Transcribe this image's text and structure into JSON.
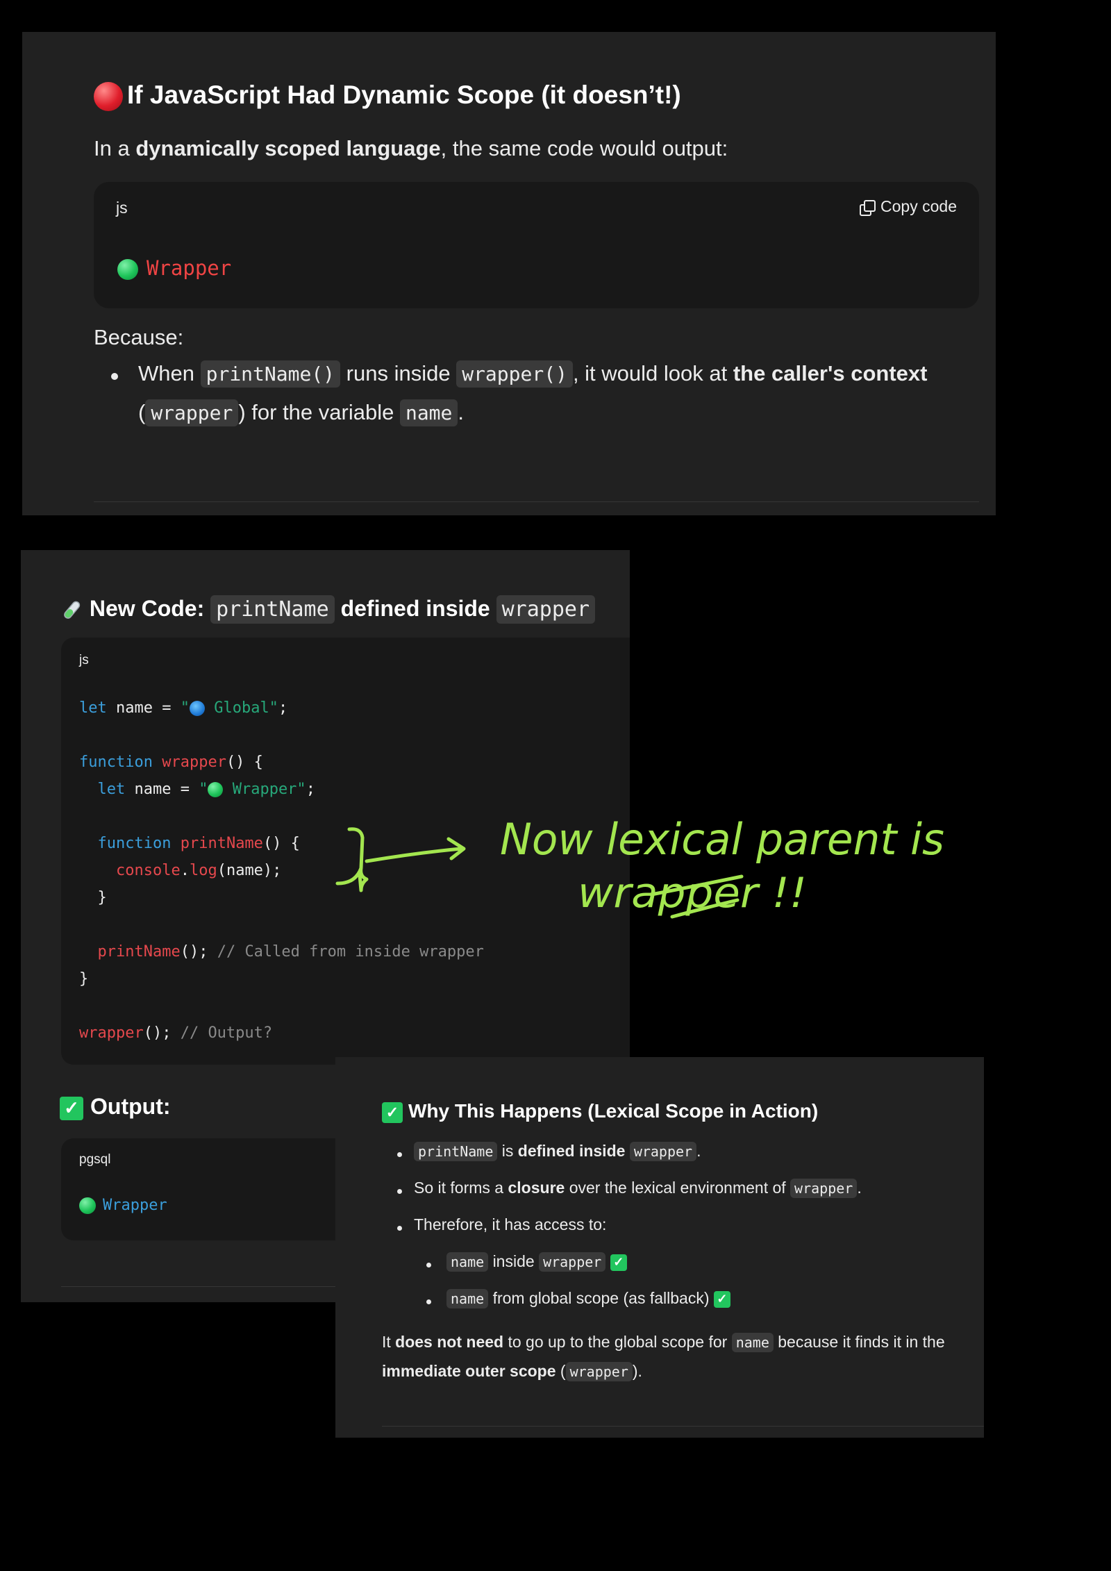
{
  "panel1": {
    "heading": "If JavaScript Had Dynamic Scope (it doesn’t!)",
    "intro_pre": "In a ",
    "intro_bold": "dynamically scoped language",
    "intro_post": ", the same code would output:",
    "code_lang": "js",
    "copy_label": "Copy code",
    "output_text": "Wrapper",
    "because": "Because:",
    "bullet_when": "When",
    "bullet_code1": "printName()",
    "bullet_runs": "runs inside",
    "bullet_code2": "wrapper()",
    "bullet_look": ", it would look at",
    "bullet_bold": "the caller's context",
    "bullet_open": "(",
    "bullet_code3": "wrapper",
    "bullet_close": ") for the variable",
    "bullet_code4": "name",
    "bullet_end": "."
  },
  "panel2": {
    "heading_pre": "New Code:",
    "heading_code1": "printName",
    "heading_mid": "defined inside",
    "heading_code2": "wrapper",
    "code_lang": "js",
    "code": {
      "l1_kw": "let",
      "l1_rest": " name = ",
      "l1_q": "\"",
      "l1_str": " Global\"",
      "l1_end": ";",
      "l3_kw": "function",
      "l3_fn": "wrapper",
      "l3_rest": "() {",
      "l4_kw": "let",
      "l4_rest": " name = ",
      "l4_q": "\"",
      "l4_str": " Wrapper\"",
      "l4_end": ";",
      "l6_kw": "function",
      "l6_fn": "printName",
      "l6_rest": "() {",
      "l7_obj": "console",
      "l7_dot": ".",
      "l7_fn": "log",
      "l7_rest": "(name);",
      "l8": "}",
      "l10_fn": "printName",
      "l10_rest": "(); ",
      "l10_cm": "// Called from inside wrapper",
      "l11": "}",
      "l13_fn": "wrapper",
      "l13_rest": "(); ",
      "l13_cm": "// Output?"
    },
    "output_heading": "Output:",
    "output_lang": "pgsql",
    "output_text": "Wrapper"
  },
  "panel3": {
    "heading": "Why This Happens (Lexical Scope in Action)",
    "b1_code1": "printName",
    "b1_is": "is",
    "b1_bold": "defined inside",
    "b1_code2": "wrapper",
    "b1_end": ".",
    "b2_pre": "So it forms a",
    "b2_bold": "closure",
    "b2_mid": "over the lexical environment of",
    "b2_code": "wrapper",
    "b2_end": ".",
    "b3": "Therefore, it has access to:",
    "s1_code1": "name",
    "s1_mid": "inside",
    "s1_code2": "wrapper",
    "s2_code": "name",
    "s2_rest": "from global scope (as fallback)",
    "p_it": "It",
    "p_bold1": "does not need",
    "p_mid": "to go up to the global scope for",
    "p_code": "name",
    "p_rest": "because it finds it in the",
    "p_bold2": "immediate outer scope",
    "p_open": "(",
    "p_code2": "wrapper",
    "p_close": ")."
  },
  "annotation": {
    "text_line1": "Now lexical parent is",
    "text_line2": "wrapper !!",
    "color": "#a3e64f"
  }
}
